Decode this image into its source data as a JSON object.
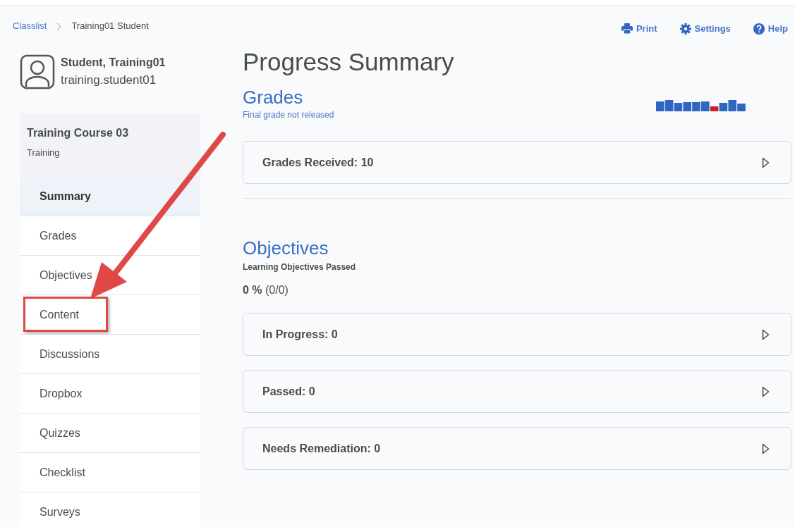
{
  "breadcrumb": [
    {
      "label": "Classlist",
      "link": true
    },
    {
      "label": "Training01 Student",
      "link": false
    }
  ],
  "actions": [
    {
      "kind": "print",
      "label": "Print"
    },
    {
      "kind": "settings",
      "label": "Settings"
    },
    {
      "kind": "help",
      "label": "Help"
    }
  ],
  "user": {
    "name": "Student, Training01",
    "username": "training.student01"
  },
  "course": {
    "title": "Training Course 03",
    "subtitle": "Training"
  },
  "sidebar": {
    "items": [
      {
        "label": "Summary",
        "selected": true,
        "highlighted": false
      },
      {
        "label": "Grades",
        "selected": false,
        "highlighted": false
      },
      {
        "label": "Objectives",
        "selected": false,
        "highlighted": false
      },
      {
        "label": "Content",
        "selected": false,
        "highlighted": true
      },
      {
        "label": "Discussions",
        "selected": false,
        "highlighted": false
      },
      {
        "label": "Dropbox",
        "selected": false,
        "highlighted": false
      },
      {
        "label": "Quizzes",
        "selected": false,
        "highlighted": false
      },
      {
        "label": "Checklist",
        "selected": false,
        "highlighted": false
      },
      {
        "label": "Surveys",
        "selected": false,
        "highlighted": false
      }
    ]
  },
  "page_title": "Progress Summary",
  "grades": {
    "heading": "Grades",
    "note": "Final grade not released",
    "panels": [
      {
        "label": "Grades Received: 10"
      }
    ]
  },
  "objectives": {
    "heading": "Objectives",
    "caption": "Learning Objectives Passed",
    "percent": "0 %",
    "fraction": "(0/0)",
    "panels": [
      {
        "label": "In Progress: 0"
      },
      {
        "label": "Passed: 0"
      },
      {
        "label": "Needs Remediation: 0"
      }
    ]
  },
  "annotation": {
    "kind": "arrow"
  }
}
